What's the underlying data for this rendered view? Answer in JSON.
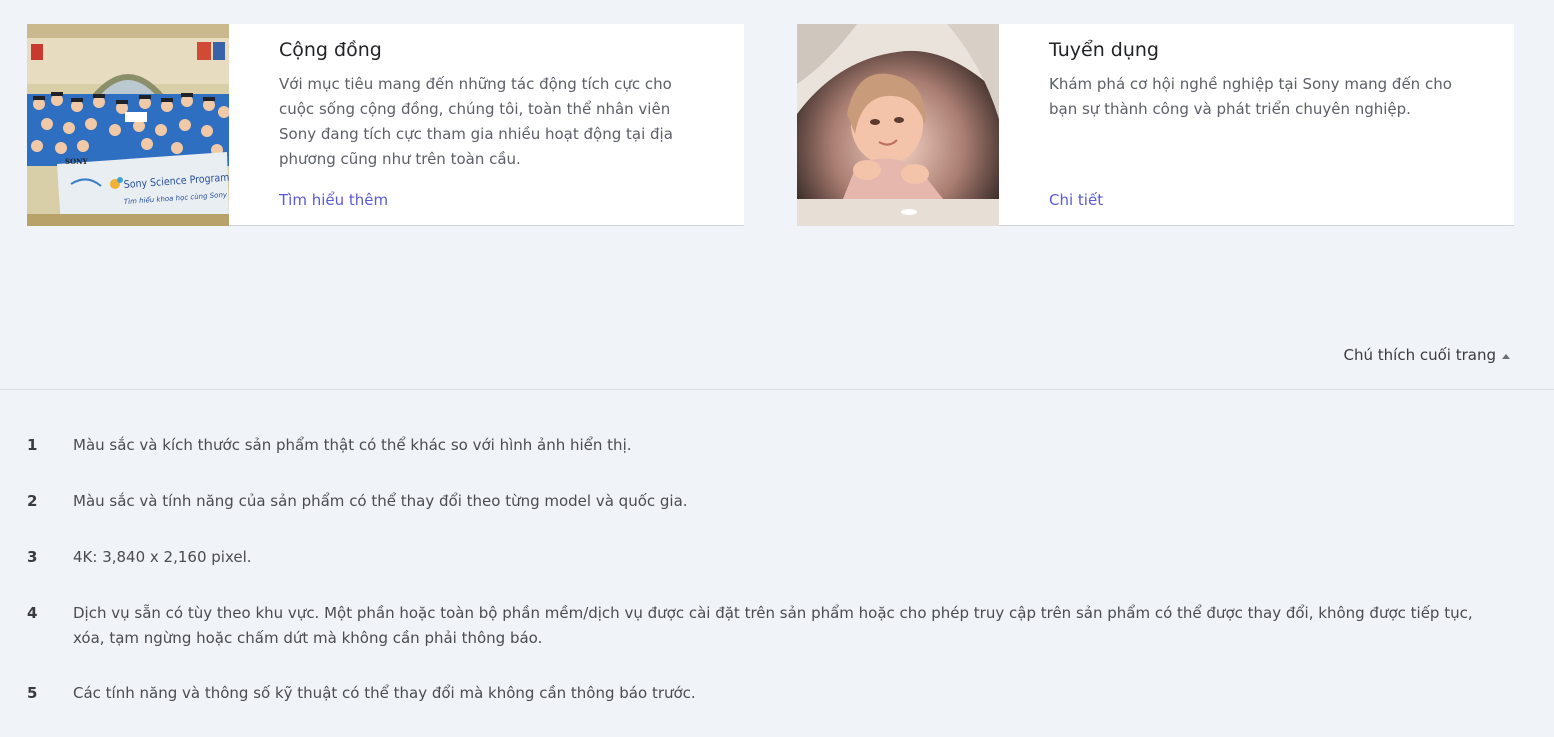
{
  "cards": [
    {
      "title": "Cộng đồng",
      "text": "Với mục tiêu mang đến những tác động tích cực cho cuộc sống cộng đồng, chúng tôi, toàn thể nhân viên Sony đang tích cực tham gia nhiều hoạt động tại địa phương cũng như trên toàn cầu.",
      "link": "Tìm hiểu thêm",
      "image_banner_brand": "SONY",
      "image_banner_title": "Sony Science Program",
      "image_banner_subtitle": "Tìm hiểu khoa học cùng Sony"
    },
    {
      "title": "Tuyển dụng",
      "text": "Khám phá cơ hội nghề nghiệp tại Sony mang đến cho bạn sự thành công và phát triển chuyên nghiệp.",
      "link": "Chi tiết"
    }
  ],
  "footnote_toggle": {
    "label": "Chú thích cuối trang",
    "icon": "caret-up-icon"
  },
  "footnotes": [
    {
      "num": "1",
      "text": "Màu sắc và kích thước sản phẩm thật có thể khác so với hình ảnh hiển thị."
    },
    {
      "num": "2",
      "text": "Màu sắc và tính năng của sản phẩm có thể thay đổi theo từng model và quốc gia."
    },
    {
      "num": "3",
      "text": "4K: 3,840 x 2,160 pixel."
    },
    {
      "num": "4",
      "text": "Dịch vụ sẵn có tùy theo khu vực. Một phần hoặc toàn bộ phần mềm/dịch vụ được cài đặt trên sản phẩm hoặc cho phép truy cập trên sản phẩm có thể được thay đổi, không được tiếp tục, xóa, tạm ngừng hoặc chấm dứt mà không cần phải thông báo."
    },
    {
      "num": "5",
      "text": "Các tính năng và thông số kỹ thuật có thể thay đổi mà không cần thông báo trước."
    }
  ],
  "colors": {
    "page_background": "#f0f3f7",
    "card_background": "#ffffff",
    "link": "#5a5ad6",
    "body_text": "#5c5f66",
    "heading": "#222326"
  }
}
